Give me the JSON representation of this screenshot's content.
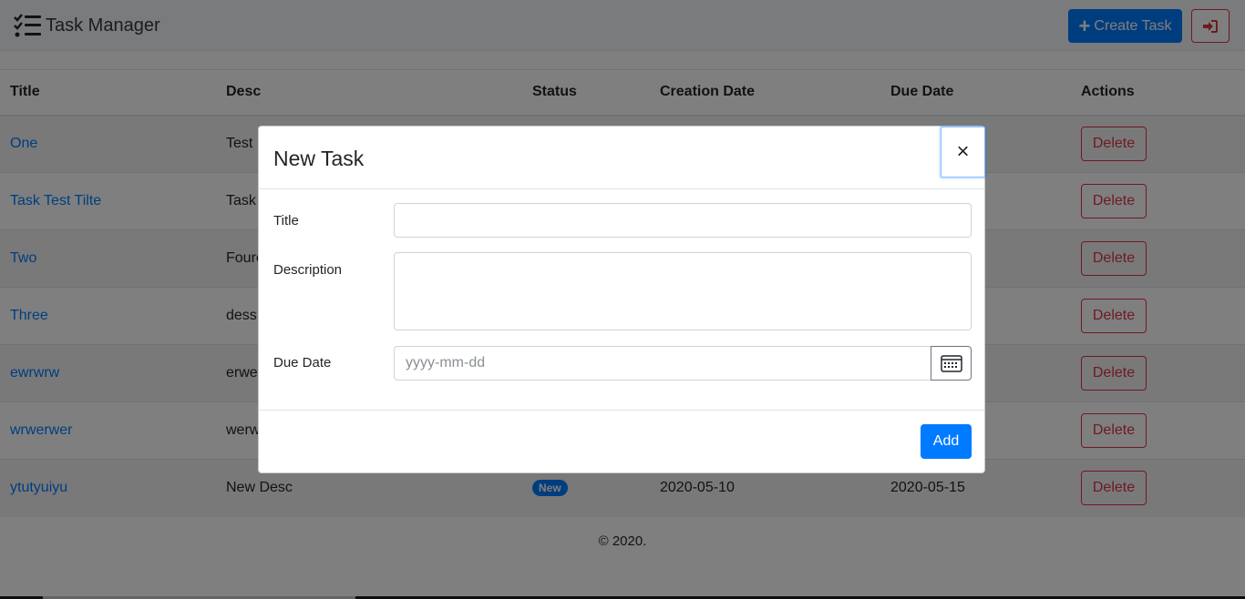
{
  "navbar": {
    "brand": "Task Manager",
    "create_label": "Create Task",
    "accent_color": "#007bff",
    "danger_color": "#dc3545"
  },
  "table": {
    "headers": [
      "Title",
      "Desc",
      "Status",
      "Creation Date",
      "Due Date",
      "Actions"
    ],
    "rows": [
      {
        "title": "One",
        "desc": "Test D",
        "status": "",
        "created": "",
        "due": "",
        "action": "Delete"
      },
      {
        "title": "Task Test Tilte",
        "desc": "Task",
        "status": "",
        "created": "",
        "due": "",
        "action": "Delete"
      },
      {
        "title": "Two",
        "desc": "Foure",
        "status": "",
        "created": "",
        "due": "",
        "action": "Delete"
      },
      {
        "title": "Three",
        "desc": "dess",
        "status": "",
        "created": "",
        "due": "",
        "action": "Delete"
      },
      {
        "title": "ewrwrw",
        "desc": "erwe",
        "status": "",
        "created": "",
        "due": "",
        "action": "Delete"
      },
      {
        "title": "wrwerwer",
        "desc": "werw",
        "status": "",
        "created": "",
        "due": "",
        "action": "Delete"
      },
      {
        "title": "ytutyuiyu",
        "desc": "New Desc",
        "status": "New",
        "created": "2020-05-10",
        "due": "2020-05-15",
        "action": "Delete"
      }
    ]
  },
  "footer": {
    "text": "© 2020."
  },
  "modal": {
    "title": "New Task",
    "close_label": "×",
    "fields": {
      "title_label": "Title",
      "title_value": "",
      "description_label": "Description",
      "description_value": "",
      "due_date_label": "Due Date",
      "due_date_value": "",
      "due_date_placeholder": "yyyy-mm-dd"
    },
    "add_label": "Add"
  }
}
